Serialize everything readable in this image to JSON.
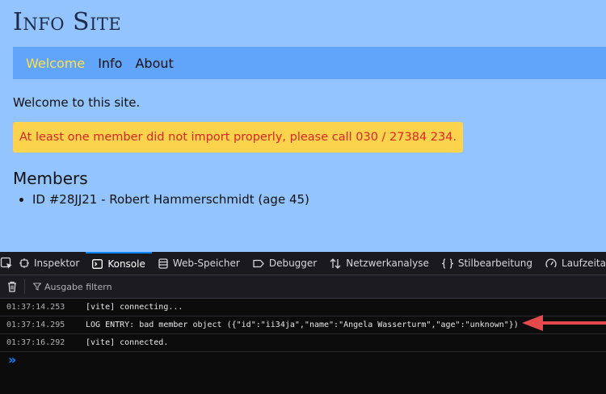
{
  "site": {
    "title": "Info Site",
    "nav": [
      "Welcome",
      "Info",
      "About"
    ],
    "welcome_text": "Welcome to this site.",
    "alert_text": "At least one member did not import properly, please call 030 / 27384 234.",
    "members_heading": "Members",
    "members": [
      "ID #28JJ21 - Robert Hammerschmidt (age 45)"
    ]
  },
  "devtools": {
    "tabs": [
      "Inspektor",
      "Konsole",
      "Web-Speicher",
      "Debugger",
      "Netzwerkanalyse",
      "Stilbearbeitung",
      "Laufzeitanalyse"
    ],
    "active_tab": "Konsole",
    "filter_placeholder": "Ausgabe filtern",
    "logs": [
      {
        "time": "01:37:14.253",
        "message": "[vite] connecting..."
      },
      {
        "time": "01:37:14.295",
        "message": "LOG ENTRY: bad member object ({\"id\":\"ii34ja\",\"name\":\"Angela Wasserturm\",\"age\":\"unknown\"})"
      },
      {
        "time": "01:37:16.292",
        "message": "[vite] connected."
      }
    ],
    "prompt_symbol": "»"
  },
  "colors": {
    "page_bg": "#93c4fd",
    "nav_bg": "#60a5fa",
    "nav_active": "#fde047",
    "alert_bg": "#fcd34d",
    "alert_text": "#dc2626",
    "arrow": "#e5484d",
    "devtools_accent": "#0a84ff"
  },
  "icons": [
    "element-picker-icon",
    "inspector-icon",
    "console-icon",
    "storage-icon",
    "debugger-icon",
    "network-icon",
    "style-editor-icon",
    "performance-icon",
    "trash-icon",
    "filter-icon"
  ]
}
